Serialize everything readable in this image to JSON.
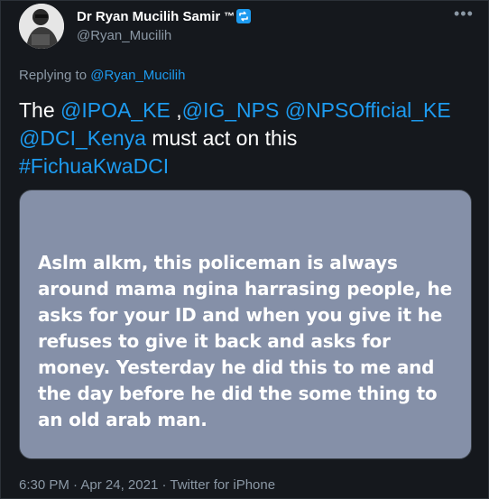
{
  "user": {
    "display_name": "Dr Ryan Mucilih Samir",
    "tm": "™",
    "handle": "@Ryan_Mucilih"
  },
  "header": {
    "more_icon": "more-horizontal-icon",
    "more_label": "•••"
  },
  "reply": {
    "prefix": "Replying to ",
    "to": "@Ryan_Mucilih"
  },
  "tweet": {
    "mention_1": "@IPOA_KE",
    "sep_1": " ,",
    "mention_2": "@IG_NPS",
    "mention_3": "@NPSOfficial_KE",
    "mention_4": "@DCI_Kenya",
    "lead": "The ",
    "tail": " must act on this",
    "hashtag": "#FichuaKwaDCI"
  },
  "media": {
    "text": "Aslm alkm, this policeman is always around mama ngina harrasing people, he asks for your ID and when you give it he refuses to give it back and asks for money. Yesterday he did this to me and the day before he did the some thing to an old arab man."
  },
  "meta": {
    "time": "6:30 PM",
    "date": "Apr 24, 2021",
    "source": "Twitter for iPhone",
    "dot": " · "
  },
  "colors": {
    "background": "#15181d",
    "link": "#1d9bf0",
    "secondary": "#8b98a5",
    "media_bg": "#8590a8"
  }
}
